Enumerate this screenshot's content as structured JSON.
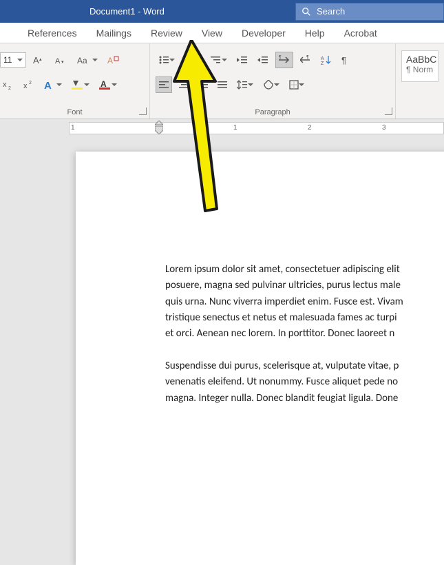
{
  "title_bar": {
    "document_title": "Document1  -  Word",
    "search_placeholder": "Search"
  },
  "ribbon_tabs": [
    "References",
    "Mailings",
    "Review",
    "View",
    "Developer",
    "Help",
    "Acrobat"
  ],
  "font_group": {
    "label": "Font",
    "font_size": "11"
  },
  "paragraph_group": {
    "label": "Paragraph"
  },
  "styles_group": {
    "preview_line1": "AaBbC",
    "preview_line2": "¶ Norm"
  },
  "ruler": {
    "numbers": [
      "1",
      "1",
      "2",
      "3"
    ]
  },
  "document_body": {
    "para1": "Lorem ipsum dolor sit amet, consectetuer adipiscing elit\nposuere, magna sed pulvinar ultricies, purus lectus male\nquis urna. Nunc viverra imperdiet enim. Fusce est. Vivam\ntristique senectus et netus et malesuada fames ac turpi\net orci. Aenean nec lorem. In porttitor. Donec laoreet n",
    "para2": "Suspendisse dui purus, scelerisque at, vulputate vitae, p\nvenenatis eleifend. Ut nonummy. Fusce aliquet pede no\nmagna. Integer nulla. Donec blandit feugiat ligula. Done"
  }
}
